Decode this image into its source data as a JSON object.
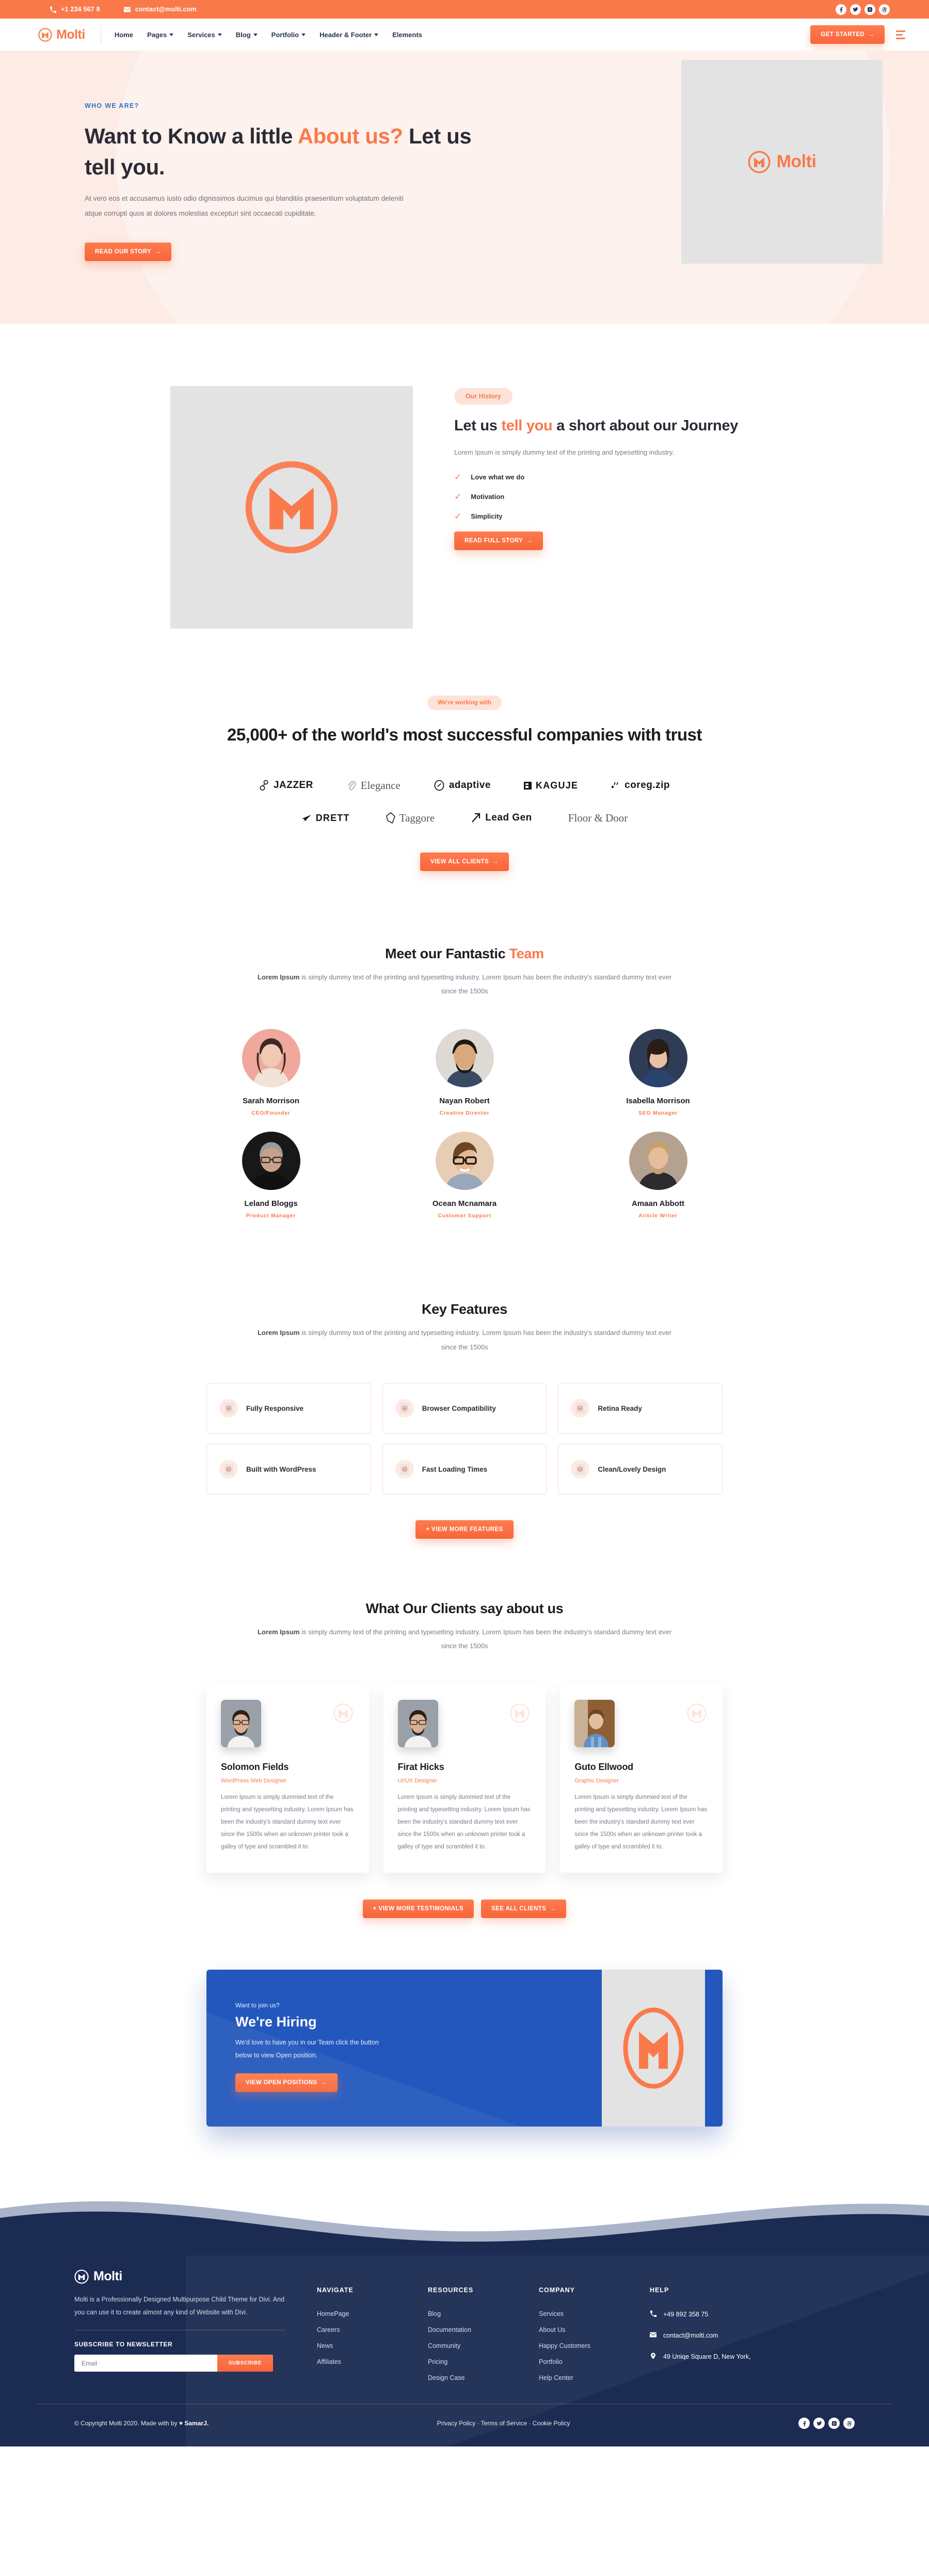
{
  "brand": {
    "name": "Molti",
    "accent": "#f9794b",
    "navy": "#1b2b52",
    "blue": "#2357bd"
  },
  "topbar": {
    "phone": "+1 234 567 8",
    "email": "contact@molti.com",
    "socials": [
      "facebook-icon",
      "twitter-icon",
      "instagram-icon",
      "dribbble-icon"
    ]
  },
  "nav": {
    "links": [
      {
        "label": "Home",
        "caret": false
      },
      {
        "label": "Pages",
        "caret": true
      },
      {
        "label": "Services",
        "caret": true
      },
      {
        "label": "Blog",
        "caret": true
      },
      {
        "label": "Portfolio",
        "caret": true
      },
      {
        "label": "Header & Footer",
        "caret": true
      },
      {
        "label": "Elements",
        "caret": false
      }
    ],
    "cta": "GET STARTED"
  },
  "hero": {
    "eyebrow": "WHO WE ARE?",
    "title_part1": "Want to Know a little ",
    "title_highlight1": "About us?",
    "title_part2": " Let us tell you.",
    "paragraph": "At vero eos et accusamus iusto odio dignissimos ducimus qui blanditiis praesentium voluptatum deleniti atque corrupti quos at dolores molestias excepturi sint occaecati cupiditate.",
    "button": "READ OUR STORY"
  },
  "journey": {
    "pill": "Our History",
    "title_part1": "Let us ",
    "title_highlight": "tell you",
    "title_part2": " a short about our Journey",
    "paragraph": "Lorem Ipsum is simply dummy text of the printing and typesetting industry.",
    "checks": [
      "Love what we do",
      "Motivation",
      "Simplicity"
    ],
    "button": "READ FULL STORY"
  },
  "clients": {
    "pill": "We're working with",
    "title": "25,000+ of the world's most successful companies with trust",
    "row1": [
      {
        "name": "JAZZER",
        "icon": "jazzer-icon",
        "style": "bold"
      },
      {
        "name": "Elegance",
        "icon": "paperclip-icon",
        "style": "serif"
      },
      {
        "name": "adaptive",
        "icon": "link-circle-icon",
        "style": "bold"
      },
      {
        "name": "KAGUJE",
        "icon": "square-icon",
        "style": "small-caps"
      },
      {
        "name": "coreg.zip",
        "icon": "dots-icon",
        "style": "bold"
      }
    ],
    "row2": [
      {
        "name": "DRETT",
        "icon": "plane-icon",
        "style": "small-caps"
      },
      {
        "name": "Taggore",
        "icon": "hexagon-icon",
        "style": "serif"
      },
      {
        "name": "Lead Gen",
        "icon": "arrow-up-right-icon",
        "style": "bold"
      },
      {
        "name": "Floor & Door",
        "icon": "none",
        "style": "serif"
      }
    ],
    "button": "VIEW ALL CLIENTS"
  },
  "team": {
    "title_part1": "Meet our Fantastic ",
    "title_highlight": "Team",
    "sub_bold": "Lorem Ipsum",
    "sub_rest": " is simply dummy text of the printing and typesetting industry. Lorem Ipsum has been the industry's standard dummy text ever since the 1500s",
    "members": [
      {
        "name": "Sarah Morrison",
        "role": "CEO/Founder",
        "bg": "#f0a79c",
        "skin": "#f0c8b4",
        "hair": "#3c2a22",
        "shirt": "#f3e2d8"
      },
      {
        "name": "Nayan Robert",
        "role": "Creative Director",
        "bg": "#dedad3",
        "skin": "#d9a87e",
        "hair": "#201812",
        "shirt": "#3a4a64"
      },
      {
        "name": "Isabella Morrison",
        "role": "SEO Manager",
        "bg": "#2e3d55",
        "skin": "#e8c0a6",
        "hair": "#2a1c16",
        "shirt": "#2a4470"
      },
      {
        "name": "Leland Bloggs",
        "role": "Product Manager",
        "bg": "#181818",
        "skin": "#c9a18a",
        "hair": "#9a9a9a",
        "shirt": "#101010"
      },
      {
        "name": "Ocean Mcnamara",
        "role": "Customer Support",
        "bg": "#e8cdb5",
        "skin": "#e8b995",
        "hair": "#6b4524",
        "shirt": "#9aa8bc"
      },
      {
        "name": "Amaan Abbott",
        "role": "Aritcle Writer",
        "bg": "#b4a190",
        "skin": "#e3bd9c",
        "hair": "#caa06a",
        "shirt": "#2c2c30"
      }
    ]
  },
  "features": {
    "title": "Key Features",
    "sub_bold": "Lorem Ipsum",
    "sub_rest": " is simply dummy text of the printing and typesetting industry. Lorem Ipsum has been the industry's standard dummy text ever since the 1500s",
    "items": [
      "Fully Responsive",
      "Browser Compatibility",
      "Retina Ready",
      "Built with WordPress",
      "Fast Loading Times",
      "Clean/Lovely Design"
    ],
    "button": "+ VIEW MORE FEATURES"
  },
  "testimonials": {
    "title": "What Our Clients say about us",
    "sub_bold": "Lorem Ipsum",
    "sub_rest": " is simply dummy text of the printing and typesetting industry. Lorem Ipsum has been the industry's standard dummy text ever since the 1500s",
    "body": "Lorem Ipsum is simply dummied text of the printing and typesetting industry. Lorem Ipsum has been the industry's standard dummy text ever since the 1500s when an unknown printer took a galley of type and scrambled it to.",
    "cards": [
      {
        "name": "Solomon Fields",
        "role": "WordPress Web Designer",
        "bg": "#9aa0a8",
        "skin": "#dcb094",
        "hair": "#2a2018",
        "shirt": "#f2f2f2"
      },
      {
        "name": "Firat Hicks",
        "role": "UI/UX Designer",
        "bg": "#9aa0a8",
        "skin": "#dcb094",
        "hair": "#2a2018",
        "shirt": "#f2f2f2"
      },
      {
        "name": "Guto Ellwood",
        "role": "Graphic Designer",
        "bg": "#8e5f35",
        "skin": "#e3be9c",
        "hair": "#6a4526",
        "shirt": "#5f8fc4"
      }
    ],
    "button_more": "+ VIEW MORE TESTIMONIALS",
    "button_all": "SEE ALL CLIENTS"
  },
  "hiring": {
    "eyebrow": "Want to join us?",
    "title": "We're Hiring",
    "paragraph": "We'd love to have you in our Team click the button below to view Open position.",
    "button": "VIEW OPEN POSITIONS"
  },
  "footer": {
    "about": "Molti is a Professionally Designed  Multipurpose Child Theme for Divi. And you can use it to create almost any kind of Website with Divi.",
    "newsletter_title": "SUBSCRIBE TO NEWSLETTER",
    "email_placeholder": "Email",
    "subscribe": "SUBSCRIBE",
    "columns": [
      {
        "head": "NAVIGATE",
        "items": [
          "HomePage",
          "Careers",
          "News",
          "Affiliates"
        ]
      },
      {
        "head": "RESOURCES",
        "items": [
          "Blog",
          "Documentation",
          "Community",
          "Pricing",
          "Design Case"
        ]
      },
      {
        "head": "COMPANY",
        "items": [
          "Services",
          "About Us",
          "Happy Customers",
          "Portfolio",
          "Help Center"
        ]
      }
    ],
    "help": {
      "head": "HELP",
      "phone": "+49 892 358 75",
      "email": "contact@molti.com",
      "address": "49 Uniqe Square D, New York,"
    },
    "copyright_pre": "© Copyright Molti 2020. Made with by ",
    "copyright_author": "SamarJ.",
    "legal": "Privacy Policy · Terms of Service · Cookie Policy",
    "socials": [
      "facebook-icon",
      "twitter-icon",
      "instagram-icon",
      "dribbble-icon"
    ]
  }
}
